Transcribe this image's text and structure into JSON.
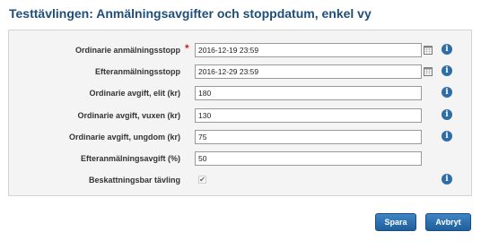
{
  "page": {
    "title": "Testtävlingen: Anmälningsavgifter och stoppdatum, enkel vy"
  },
  "fields": [
    {
      "label": "Ordinarie anmälningsstopp",
      "required_mark": "*",
      "value": "2016-12-19 23:59"
    },
    {
      "label": "Efteranmälningsstopp",
      "value": "2016-12-29 23:59"
    },
    {
      "label": "Ordinarie avgift, elit (kr)",
      "value": "180"
    },
    {
      "label": "Ordinarie avgift, vuxen (kr)",
      "value": "130"
    },
    {
      "label": "Ordinarie avgift, ungdom (kr)",
      "value": "75"
    },
    {
      "label": "Efteranmälningsavgift (%)",
      "value": "50"
    },
    {
      "label": "Beskattningsbar tävling",
      "checked": true,
      "check_glyph": "✔"
    }
  ],
  "info_icon": {
    "glyph": "i",
    "color": "#2e6ea6"
  },
  "buttons": {
    "save_label": "Spara",
    "cancel_label": "Avbryt"
  },
  "colors": {
    "title": "#1f4e79",
    "button": "#2a6fb0",
    "required": "#cc2222"
  }
}
